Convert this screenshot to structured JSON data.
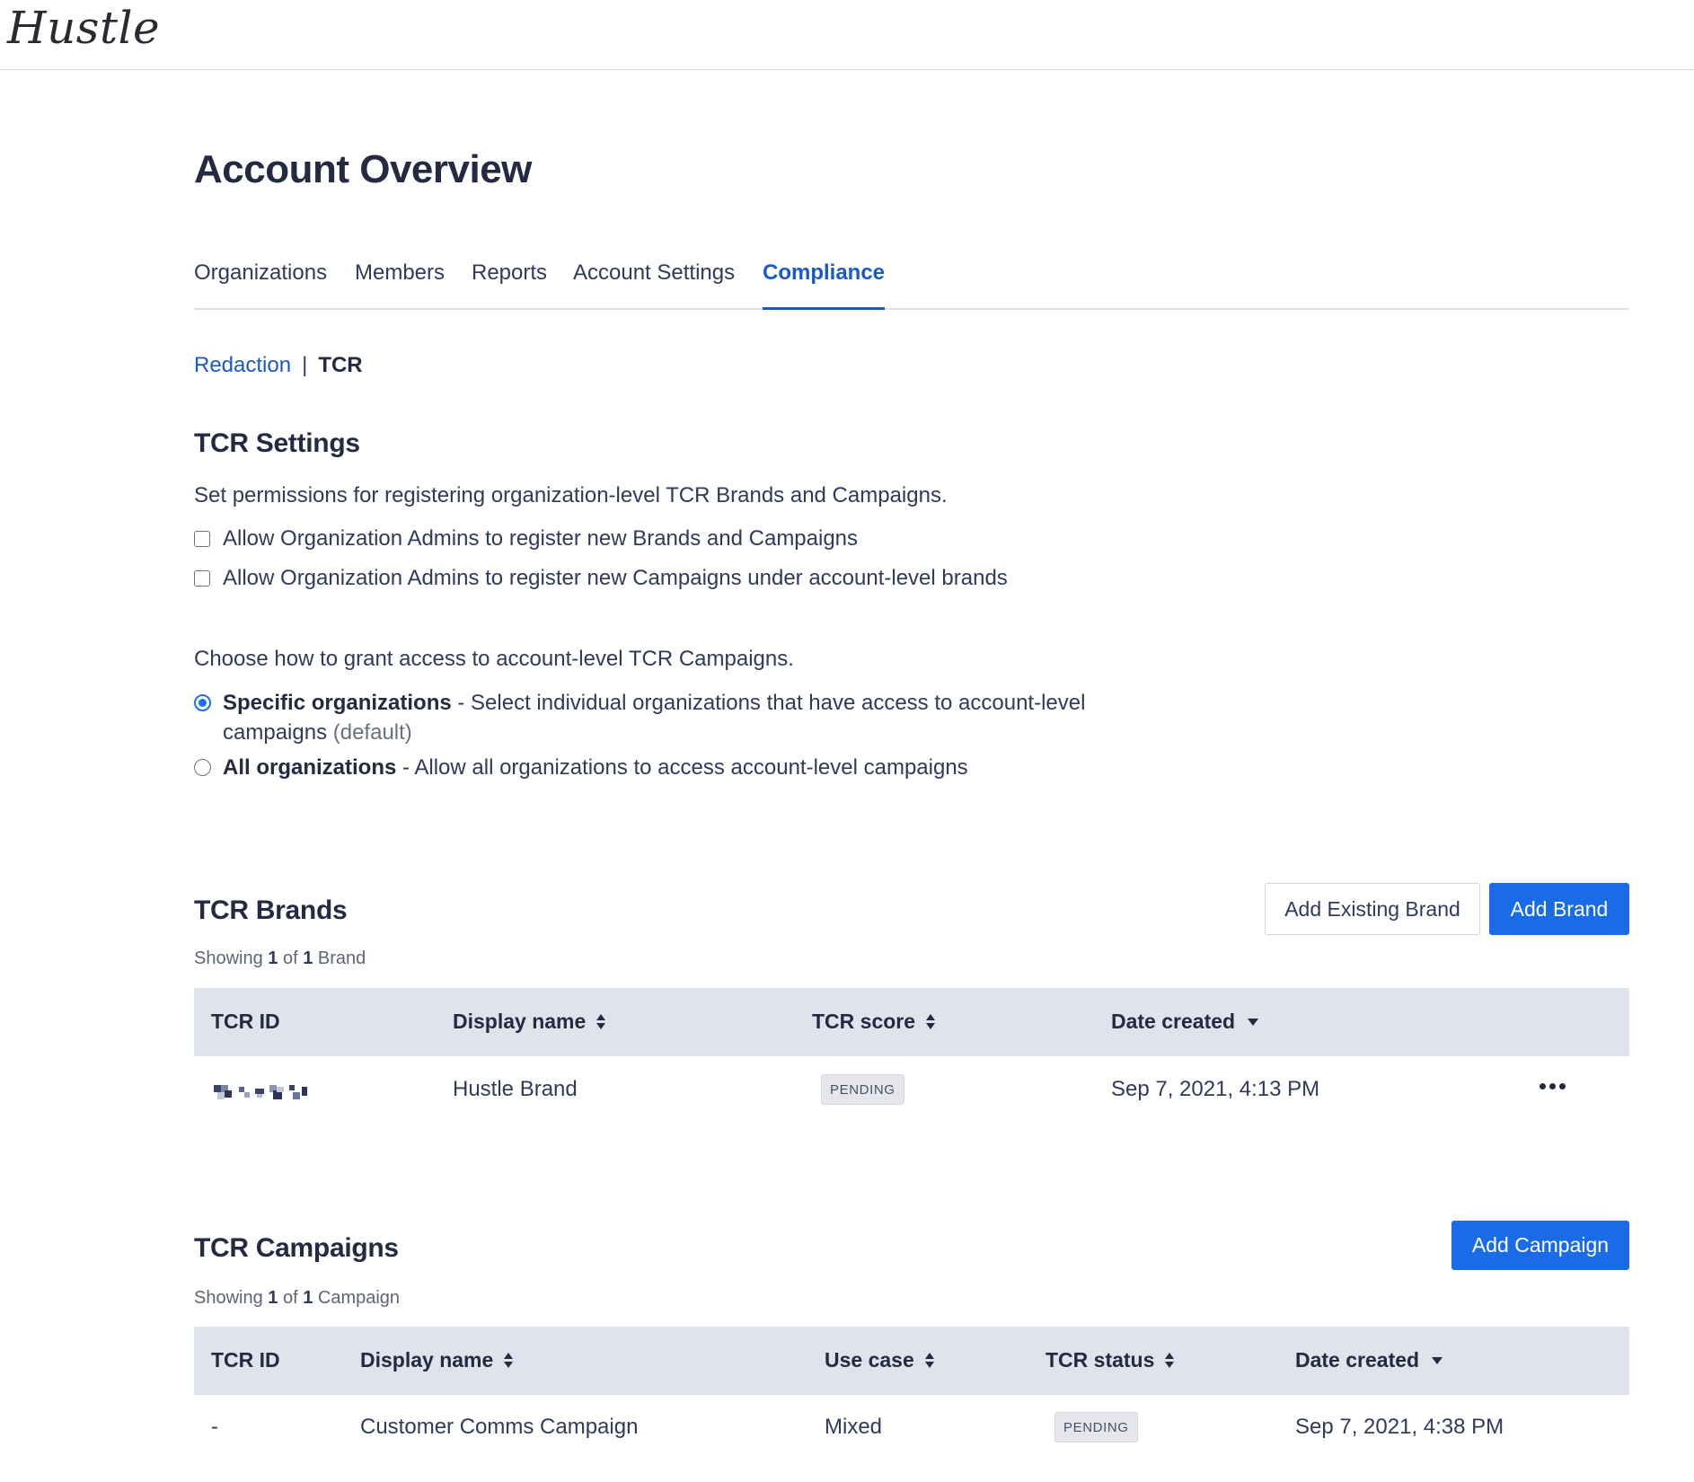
{
  "app": {
    "logo": "Hustle"
  },
  "page": {
    "title": "Account Overview"
  },
  "tabs": [
    {
      "label": "Organizations"
    },
    {
      "label": "Members"
    },
    {
      "label": "Reports"
    },
    {
      "label": "Account Settings"
    },
    {
      "label": "Compliance",
      "active": true
    }
  ],
  "subnav": {
    "link": "Redaction",
    "separator": "|",
    "current": "TCR"
  },
  "settings": {
    "heading": "TCR Settings",
    "description": "Set permissions for registering organization-level TCR Brands and Campaigns.",
    "checkboxes": [
      {
        "label": "Allow Organization Admins to register new Brands and Campaigns",
        "checked": false
      },
      {
        "label": "Allow Organization Admins to register new Campaigns under account-level brands",
        "checked": false
      }
    ],
    "access_prompt": "Choose how to grant access to account-level TCR Campaigns.",
    "radios": [
      {
        "title": "Specific organizations",
        "text": " - Select individual organizations that have access to account-level campaigns",
        "suffix": "(default)",
        "selected": true
      },
      {
        "title": "All organizations",
        "text": " - Allow all organizations to access account-level campaigns",
        "selected": false
      }
    ]
  },
  "brands": {
    "heading": "TCR Brands",
    "add_existing_label": "Add Existing Brand",
    "add_label": "Add Brand",
    "showing": {
      "prefix": "Showing ",
      "shown": "1",
      "of": " of ",
      "total": "1",
      "noun": " Brand"
    },
    "columns": [
      "TCR ID",
      "Display name",
      "TCR score",
      "Date created"
    ],
    "rows": [
      {
        "tcr_id": "redacted",
        "display_name": "Hustle Brand",
        "tcr_score": "PENDING",
        "date_created": "Sep 7, 2021, 4:13 PM"
      }
    ]
  },
  "campaigns": {
    "heading": "TCR Campaigns",
    "add_label": "Add Campaign",
    "showing": {
      "prefix": "Showing ",
      "shown": "1",
      "of": " of ",
      "total": "1",
      "noun": " Campaign"
    },
    "columns": [
      "TCR ID",
      "Display name",
      "Use case",
      "TCR status",
      "Date created"
    ],
    "rows": [
      {
        "tcr_id": "-",
        "display_name": "Customer Comms Campaign",
        "use_case": "Mixed",
        "tcr_status": "PENDING",
        "date_created": "Sep 7, 2021, 4:38 PM"
      }
    ]
  },
  "colors": {
    "accent": "#1a59c7",
    "primary_button": "#1a6be8",
    "table_header": "#dfe3ec",
    "text": "#2f3a5c"
  },
  "icons": {
    "sort": "sort-arrows-icon",
    "sort_desc": "caret-down-icon",
    "row_menu": "more-horizontal-icon"
  }
}
